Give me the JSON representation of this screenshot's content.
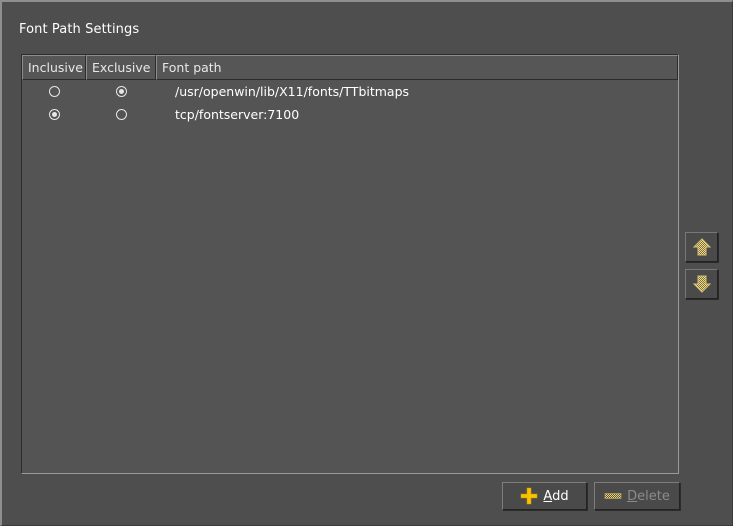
{
  "window": {
    "group_title": "Font Path Settings",
    "background_color": "#4e4e4e"
  },
  "table": {
    "columns": [
      {
        "key": "inclusive",
        "label": "Inclusive"
      },
      {
        "key": "exclusive",
        "label": "Exclusive"
      },
      {
        "key": "path",
        "label": "Font path"
      }
    ],
    "rows": [
      {
        "inclusive_selected": false,
        "exclusive_selected": true,
        "path": "/usr/openwin/lib/X11/fonts/TTbitmaps"
      },
      {
        "inclusive_selected": true,
        "exclusive_selected": false,
        "path": "tcp/fontserver:7100"
      }
    ]
  },
  "side_buttons": [
    {
      "name": "move-up",
      "icon": "arrow-up-icon",
      "enabled": false
    },
    {
      "name": "move-down",
      "icon": "arrow-down-icon",
      "enabled": false
    }
  ],
  "actions": {
    "add": {
      "label_prefix": "",
      "label_accel": "A",
      "label_suffix": "dd",
      "full_label": "Add",
      "icon": "plus-icon",
      "enabled": true
    },
    "delete": {
      "label_accel": "D",
      "label_suffix": "elete",
      "full_label": "Delete",
      "icon": "minus-icon",
      "enabled": false
    }
  },
  "colors": {
    "accent_yellow": "#f5c518",
    "panel": "#545454",
    "text": "#ffffff",
    "disabled_text": "#8b8b8b"
  }
}
